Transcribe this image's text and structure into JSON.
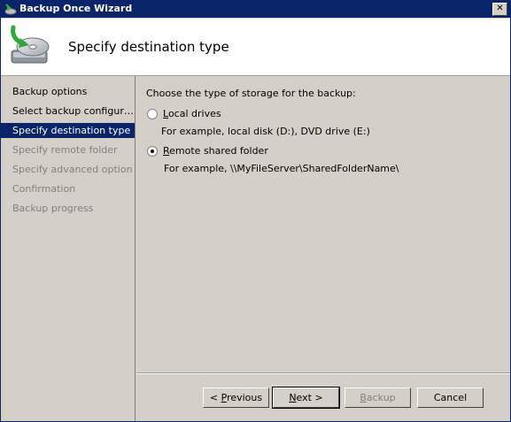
{
  "window": {
    "title": "Backup Once Wizard",
    "close_glyph": "✕"
  },
  "header": {
    "title": "Specify destination type",
    "icon": "backup-disk-icon"
  },
  "sidebar": {
    "steps": [
      {
        "label": "Backup options",
        "state": "done"
      },
      {
        "label": "Select backup configur…",
        "state": "done"
      },
      {
        "label": "Specify destination type",
        "state": "current"
      },
      {
        "label": "Specify remote folder",
        "state": "future"
      },
      {
        "label": "Specify advanced option",
        "state": "future"
      },
      {
        "label": "Confirmation",
        "state": "future"
      },
      {
        "label": "Backup progress",
        "state": "future"
      }
    ]
  },
  "content": {
    "prompt": "Choose the type of storage for the backup:",
    "options": [
      {
        "label_first": "L",
        "label_rest": "ocal drives",
        "example": "For example, local disk (D:), DVD drive (E:)",
        "selected": false
      },
      {
        "label_first": "R",
        "label_rest": "emote shared folder",
        "example": "For example, \\\\MyFileServer\\SharedFolderName\\",
        "selected": true
      }
    ]
  },
  "buttons": {
    "previous": {
      "prefix": "< ",
      "mnemonic": "P",
      "rest": "revious"
    },
    "next": {
      "mnemonic": "N",
      "rest": "ext >"
    },
    "backup": {
      "mnemonic": "B",
      "rest": "ackup",
      "enabled": false
    },
    "cancel": {
      "label": "Cancel"
    }
  }
}
